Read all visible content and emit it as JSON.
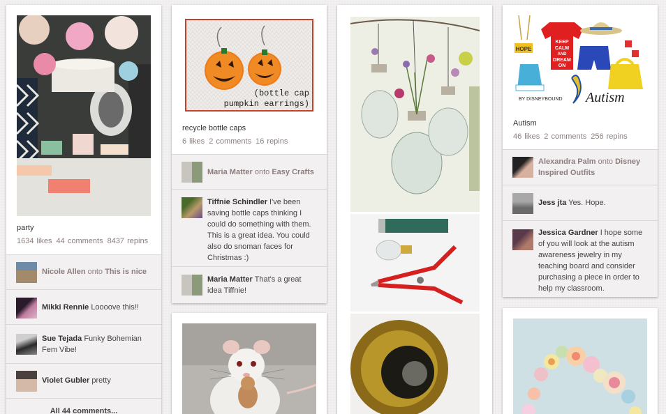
{
  "pins": {
    "party": {
      "description": "party",
      "likes": "1634 likes",
      "comments": "44 comments",
      "repins": "8437 repins",
      "activity": [
        {
          "user": "Nicole Allen",
          "onto": "onto",
          "board": "This is nice"
        },
        {
          "user": "Mikki Rennie",
          "text": "Loooove this!!"
        },
        {
          "user": "Sue Tejada",
          "text": "Funky Bohemian Fem Vibe!"
        },
        {
          "user": "Violet Gubler",
          "text": "pretty"
        }
      ],
      "more_comments": "All 44 comments..."
    },
    "bottle_caps": {
      "image_caption": "(bottle cap pumpkin earrings)",
      "description": "recycle bottle caps",
      "likes": "6 likes",
      "comments": "2 comments",
      "repins": "16 repins",
      "activity": [
        {
          "user": "Maria Matter",
          "onto": "onto",
          "board": "Easy Crafts"
        },
        {
          "user": "Tiffnie Schindler",
          "text": "I've been saving bottle caps thinking I could do something with them. This is a great idea. You could also do snoman faces for Christmas :)"
        },
        {
          "user": "Maria Matter",
          "text": "That's a great idea Tiffnie!"
        }
      ]
    },
    "autism": {
      "image_text": {
        "hope": "HOPE",
        "shirt": "KEEP CALM AND DREAM ON",
        "brand": "BY DISNEYBOUND",
        "word": "Autism"
      },
      "description": "Autism",
      "likes": "46 likes",
      "comments": "2 comments",
      "repins": "256 repins",
      "activity": [
        {
          "user": "Alexandra Palm",
          "onto": "onto",
          "board": "Disney Inspired Outfits"
        },
        {
          "user": "Jess jta",
          "text": "Yes. Hope."
        },
        {
          "user": "Jessica Gardner",
          "text": "I hope some of you will look at the autism awareness jewelry in my teaching board and consider purchasing a piece in order to help my classroom."
        }
      ]
    }
  },
  "colors": {
    "background": "#f2f0f0",
    "card": "#ffffff",
    "comment_area": "#f2f0f0",
    "muted_text": "#8c7e7e"
  }
}
